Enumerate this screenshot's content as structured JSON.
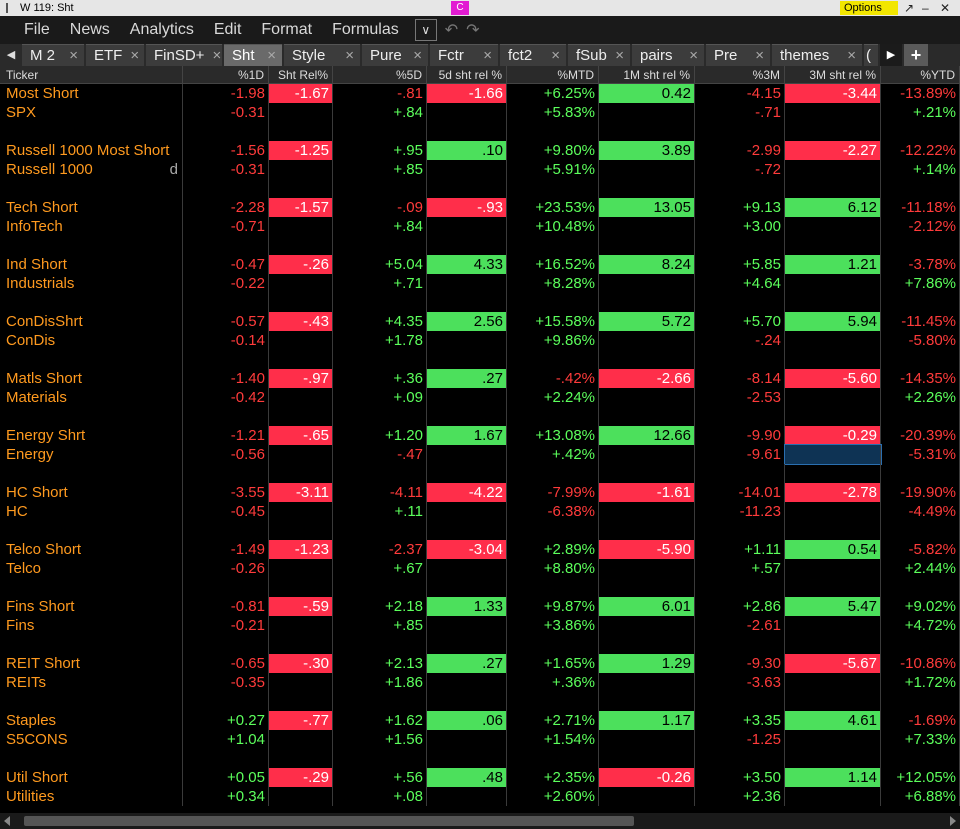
{
  "window": {
    "title": "W 119: Sht",
    "c_label": "C",
    "options_label": "Options"
  },
  "menu": {
    "items": [
      "File",
      "News",
      "Analytics",
      "Edit",
      "Format",
      "Formulas"
    ]
  },
  "tabs": [
    {
      "label": "M 2",
      "active": false
    },
    {
      "label": "ETF",
      "active": false
    },
    {
      "label": "FinSD+",
      "active": false
    },
    {
      "label": "Sht",
      "active": true
    },
    {
      "label": "Style",
      "active": false
    },
    {
      "label": "Pure",
      "active": false
    },
    {
      "label": "Fctr",
      "active": false
    },
    {
      "label": "fct2",
      "active": false
    },
    {
      "label": "fSub",
      "active": false
    },
    {
      "label": "pairs",
      "active": false
    },
    {
      "label": "Pre",
      "active": false
    },
    {
      "label": "themes",
      "active": false
    },
    {
      "label": "(",
      "active": false
    }
  ],
  "columns": [
    "Ticker",
    "%1D",
    "Sht Rel%",
    "%5D",
    "5d sht rel %",
    "%MTD",
    "1M sht rel %",
    "%3M",
    "3M sht rel %",
    "%YTD"
  ],
  "groups": [
    {
      "short": {
        "name": "Most Short",
        "v": [
          "-1.98",
          "-1.67",
          "-.81",
          "-1.66",
          "+6.25%",
          "0.42",
          "-4.15",
          "-3.44",
          "-13.89%"
        ]
      },
      "bench": {
        "name": "SPX",
        "d": "",
        "v": [
          "-0.31",
          "",
          "+.84",
          "",
          "+5.83%",
          "",
          "-.71",
          "",
          "+.21%"
        ]
      }
    },
    {
      "short": {
        "name": "Russell 1000 Most Short",
        "v": [
          "-1.56",
          "-1.25",
          "+.95",
          ".10",
          "+9.80%",
          "3.89",
          "-2.99",
          "-2.27",
          "-12.22%"
        ]
      },
      "bench": {
        "name": "Russell 1000",
        "d": "d",
        "v": [
          "-0.31",
          "",
          "+.85",
          "",
          "+5.91%",
          "",
          "-.72",
          "",
          "+.14%"
        ]
      }
    },
    {
      "short": {
        "name": "Tech Short",
        "v": [
          "-2.28",
          "-1.57",
          "-.09",
          "-.93",
          "+23.53%",
          "13.05",
          "+9.13",
          "6.12",
          "-11.18%"
        ]
      },
      "bench": {
        "name": "InfoTech",
        "d": "",
        "v": [
          "-0.71",
          "",
          "+.84",
          "",
          "+10.48%",
          "",
          "+3.00",
          "",
          "-2.12%"
        ]
      }
    },
    {
      "short": {
        "name": "Ind Short",
        "v": [
          "-0.47",
          "-.26",
          "+5.04",
          "4.33",
          "+16.52%",
          "8.24",
          "+5.85",
          "1.21",
          "-3.78%"
        ]
      },
      "bench": {
        "name": "Industrials",
        "d": "",
        "v": [
          "-0.22",
          "",
          "+.71",
          "",
          "+8.28%",
          "",
          "+4.64",
          "",
          "+7.86%"
        ]
      }
    },
    {
      "short": {
        "name": "ConDisShrt",
        "v": [
          "-0.57",
          "-.43",
          "+4.35",
          "2.56",
          "+15.58%",
          "5.72",
          "+5.70",
          "5.94",
          "-11.45%"
        ]
      },
      "bench": {
        "name": "ConDis",
        "d": "",
        "v": [
          "-0.14",
          "",
          "+1.78",
          "",
          "+9.86%",
          "",
          "-.24",
          "",
          "-5.80%"
        ]
      }
    },
    {
      "short": {
        "name": "Matls Short",
        "v": [
          "-1.40",
          "-.97",
          "+.36",
          ".27",
          "-.42%",
          "-2.66",
          "-8.14",
          "-5.60",
          "-14.35%"
        ]
      },
      "bench": {
        "name": "Materials",
        "d": "",
        "v": [
          "-0.42",
          "",
          "+.09",
          "",
          "+2.24%",
          "",
          "-2.53",
          "",
          "+2.26%"
        ]
      }
    },
    {
      "short": {
        "name": "Energy Shrt",
        "v": [
          "-1.21",
          "-.65",
          "+1.20",
          "1.67",
          "+13.08%",
          "12.66",
          "-9.90",
          "-0.29",
          "-20.39%"
        ]
      },
      "bench": {
        "name": "Energy",
        "d": "",
        "v": [
          "-0.56",
          "",
          "-.47",
          "",
          "+.42%",
          "",
          "-9.61",
          "",
          "-5.31%"
        ]
      }
    },
    {
      "short": {
        "name": "HC Short",
        "v": [
          "-3.55",
          "-3.11",
          "-4.11",
          "-4.22",
          "-7.99%",
          "-1.61",
          "-14.01",
          "-2.78",
          "-19.90%"
        ]
      },
      "bench": {
        "name": "HC",
        "d": "",
        "v": [
          "-0.45",
          "",
          "+.11",
          "",
          "-6.38%",
          "",
          "-11.23",
          "",
          "-4.49%"
        ]
      }
    },
    {
      "short": {
        "name": "Telco Short",
        "v": [
          "-1.49",
          "-1.23",
          "-2.37",
          "-3.04",
          "+2.89%",
          "-5.90",
          "+1.11",
          "0.54",
          "-5.82%"
        ]
      },
      "bench": {
        "name": "Telco",
        "d": "",
        "v": [
          "-0.26",
          "",
          "+.67",
          "",
          "+8.80%",
          "",
          "+.57",
          "",
          "+2.44%"
        ]
      }
    },
    {
      "short": {
        "name": "Fins Short",
        "v": [
          "-0.81",
          "-.59",
          "+2.18",
          "1.33",
          "+9.87%",
          "6.01",
          "+2.86",
          "5.47",
          "+9.02%"
        ]
      },
      "bench": {
        "name": "Fins",
        "d": "",
        "v": [
          "-0.21",
          "",
          "+.85",
          "",
          "+3.86%",
          "",
          "-2.61",
          "",
          "+4.72%"
        ]
      }
    },
    {
      "short": {
        "name": "REIT Short",
        "v": [
          "-0.65",
          "-.30",
          "+2.13",
          ".27",
          "+1.65%",
          "1.29",
          "-9.30",
          "-5.67",
          "-10.86%"
        ]
      },
      "bench": {
        "name": "REITs",
        "d": "",
        "v": [
          "-0.35",
          "",
          "+1.86",
          "",
          "+.36%",
          "",
          "-3.63",
          "",
          "+1.72%"
        ]
      }
    },
    {
      "short": {
        "name": "Staples",
        "v": [
          "+0.27",
          "-.77",
          "+1.62",
          ".06",
          "+2.71%",
          "1.17",
          "+3.35",
          "4.61",
          "-1.69%"
        ]
      },
      "bench": {
        "name": "S5CONS",
        "d": "",
        "v": [
          "+1.04",
          "",
          "+1.56",
          "",
          "+1.54%",
          "",
          "-1.25",
          "",
          "+7.33%"
        ]
      }
    },
    {
      "short": {
        "name": "Util Short",
        "v": [
          "+0.05",
          "-.29",
          "+.56",
          ".48",
          "+2.35%",
          "-0.26",
          "+3.50",
          "1.14",
          "+12.05%"
        ]
      },
      "bench": {
        "name": "Utilities",
        "d": "",
        "v": [
          "+0.34",
          "",
          "+.08",
          "",
          "+2.60%",
          "",
          "+2.36",
          "",
          "+6.88%"
        ]
      }
    }
  ]
}
